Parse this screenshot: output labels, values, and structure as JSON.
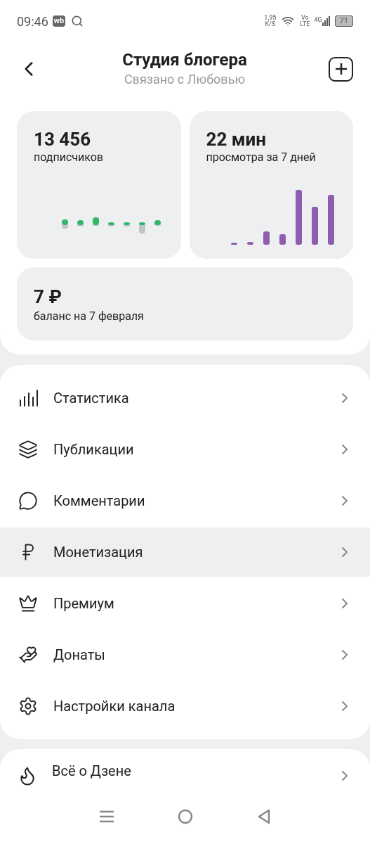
{
  "status_bar": {
    "time": "09:46",
    "app_badge": "wb",
    "speed": "1,95",
    "speed_unit": "K/S",
    "volte_top": "Vo",
    "volte_bottom": "LTE",
    "network": "4G",
    "battery": "71"
  },
  "header": {
    "title": "Студия блогера",
    "subtitle": "Связано с Любовью"
  },
  "stats": [
    {
      "kind": "subscribers",
      "value": "13 456",
      "label": "подписчиков"
    },
    {
      "kind": "views",
      "value": "22 мин",
      "label": "просмотра за 7 дней"
    }
  ],
  "balance": {
    "value": "7 ₽",
    "label": "баланс на 7 февраля"
  },
  "menu": [
    {
      "label": "Статистика",
      "selected": false
    },
    {
      "label": "Публикации",
      "selected": false
    },
    {
      "label": "Комментарии",
      "selected": false
    },
    {
      "label": "Монетизация",
      "selected": true
    },
    {
      "label": "Премиум",
      "selected": false
    },
    {
      "label": "Донаты",
      "selected": false
    },
    {
      "label": "Настройки канала",
      "selected": false
    }
  ],
  "about": {
    "label": "Всё о Дзене"
  }
}
